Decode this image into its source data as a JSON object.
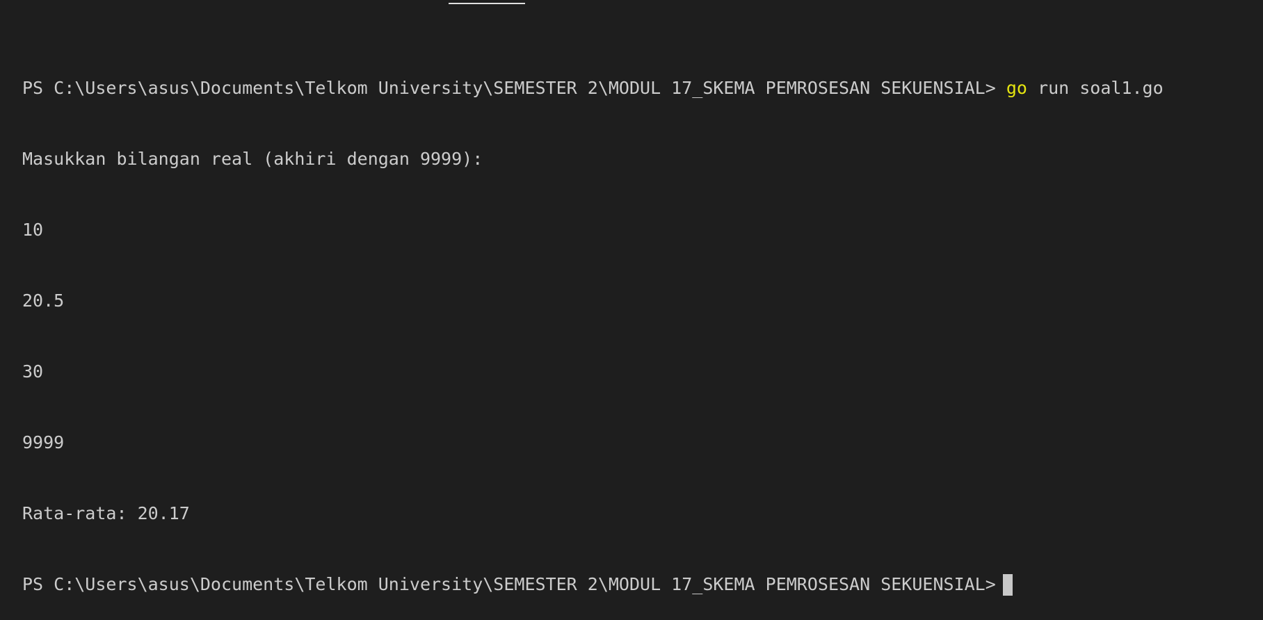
{
  "terminal": {
    "prompt_path": "PS C:\\Users\\asus\\Documents\\Telkom University\\SEMESTER 2\\MODUL 17_SKEMA PEMROSESAN SEKUENSIAL>",
    "command_keyword": "go",
    "command_rest": "run soal1.go",
    "output_lines": [
      "Masukkan bilangan real (akhiri dengan 9999):",
      "10",
      "20.5",
      "30",
      "9999",
      "Rata-rata: 20.17"
    ],
    "final_prompt": "PS C:\\Users\\asus\\Documents\\Telkom University\\SEMESTER 2\\MODUL 17_SKEMA PEMROSESAN SEKUENSIAL>"
  },
  "colors": {
    "background": "#1e1e1e",
    "text": "#cccccc",
    "command_highlight": "#e5e510",
    "cursor": "#c8c8c8"
  }
}
